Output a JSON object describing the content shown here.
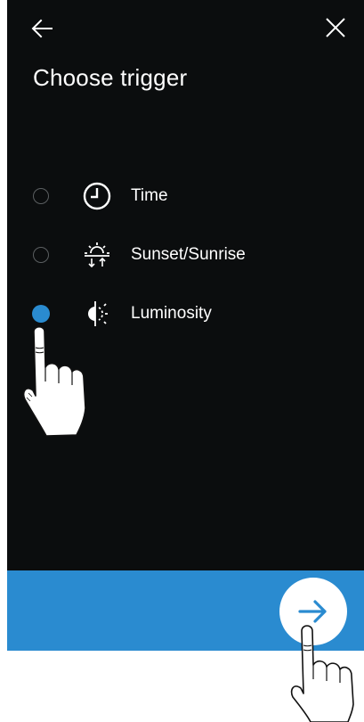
{
  "header": {
    "back_icon": "arrow-left-icon",
    "close_icon": "close-icon",
    "title": "Choose trigger"
  },
  "options": [
    {
      "label": "Time",
      "icon": "clock-icon",
      "selected": false
    },
    {
      "label": "Sunset/Sunrise",
      "icon": "sunset-sunrise-icon",
      "selected": false
    },
    {
      "label": "Luminosity",
      "icon": "luminosity-icon",
      "selected": true
    }
  ],
  "footer": {
    "next_icon": "arrow-right-icon"
  },
  "colors": {
    "background": "#0b0d0e",
    "accent": "#2a8bd0",
    "text": "#ffffff"
  }
}
